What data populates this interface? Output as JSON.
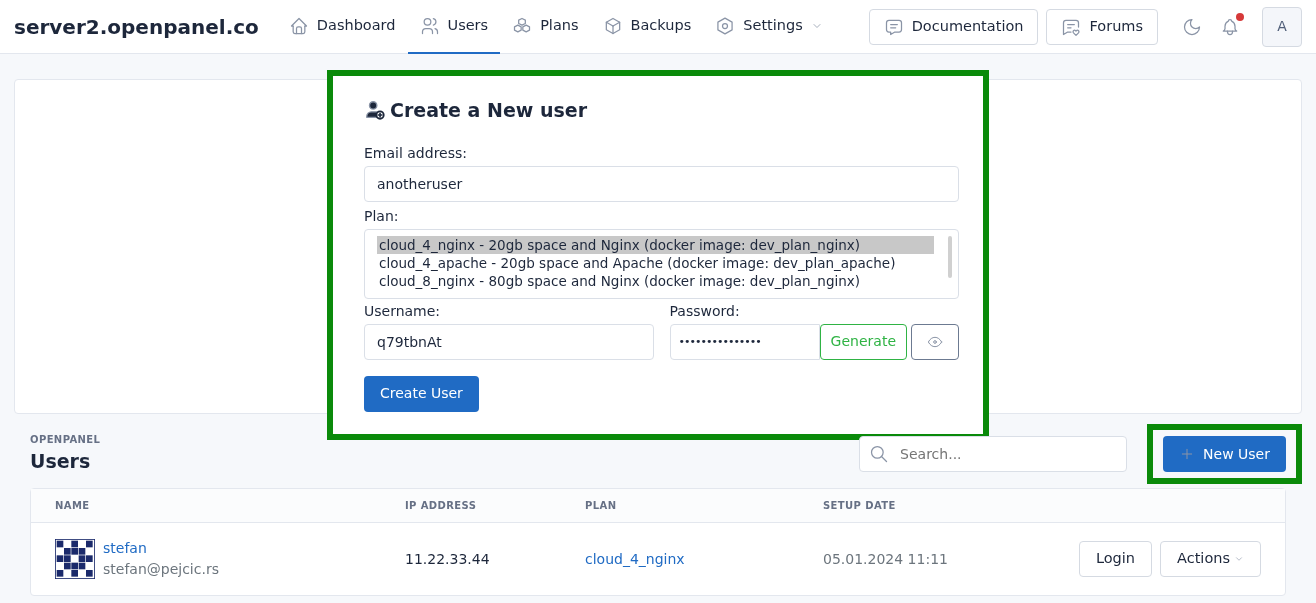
{
  "brand": "server2.openpanel.co",
  "nav": [
    {
      "label": "Dashboard",
      "selected": false,
      "dropdown": false
    },
    {
      "label": "Users",
      "selected": true,
      "dropdown": false
    },
    {
      "label": "Plans",
      "selected": false,
      "dropdown": false
    },
    {
      "label": "Backups",
      "selected": false,
      "dropdown": false
    },
    {
      "label": "Settings",
      "selected": false,
      "dropdown": true
    }
  ],
  "header_buttons": [
    {
      "label": "Documentation"
    },
    {
      "label": "Forums"
    }
  ],
  "notifications": {
    "unread": true
  },
  "avatar_letter": "A",
  "create_form": {
    "title": "Create a New user",
    "highlighted": true,
    "email": {
      "label": "Email address:",
      "value": "anotheruser"
    },
    "plan": {
      "label": "Plan:",
      "options": [
        {
          "text": "cloud_4_nginx - 20gb space and Nginx (docker image: dev_plan_nginx)",
          "selected": true
        },
        {
          "text": "cloud_4_apache - 20gb space and Apache (docker image: dev_plan_apache)",
          "selected": false
        },
        {
          "text": "cloud_8_nginx - 80gb space and Nginx (docker image: dev_plan_nginx)",
          "selected": false
        }
      ]
    },
    "username": {
      "label": "Username:",
      "value": "q79tbnAt"
    },
    "password": {
      "label": "Password:",
      "value": "•••••••••••••••",
      "generate": "Generate"
    },
    "submit": "Create User"
  },
  "section": {
    "pretitle": "OPENPANEL",
    "title": "Users",
    "search_placeholder": "Search...",
    "new_button": "New User",
    "new_highlighted": true
  },
  "table": {
    "columns": [
      "NAME",
      "IP ADDRESS",
      "PLAN",
      "SETUP DATE"
    ],
    "rows": [
      {
        "name": "stefan",
        "email": "stefan@pejcic.rs",
        "ip": "11.22.33.44",
        "plan": "cloud_4_nginx",
        "date": "05.01.2024 11:11",
        "login": "Login",
        "actions": "Actions"
      }
    ]
  }
}
